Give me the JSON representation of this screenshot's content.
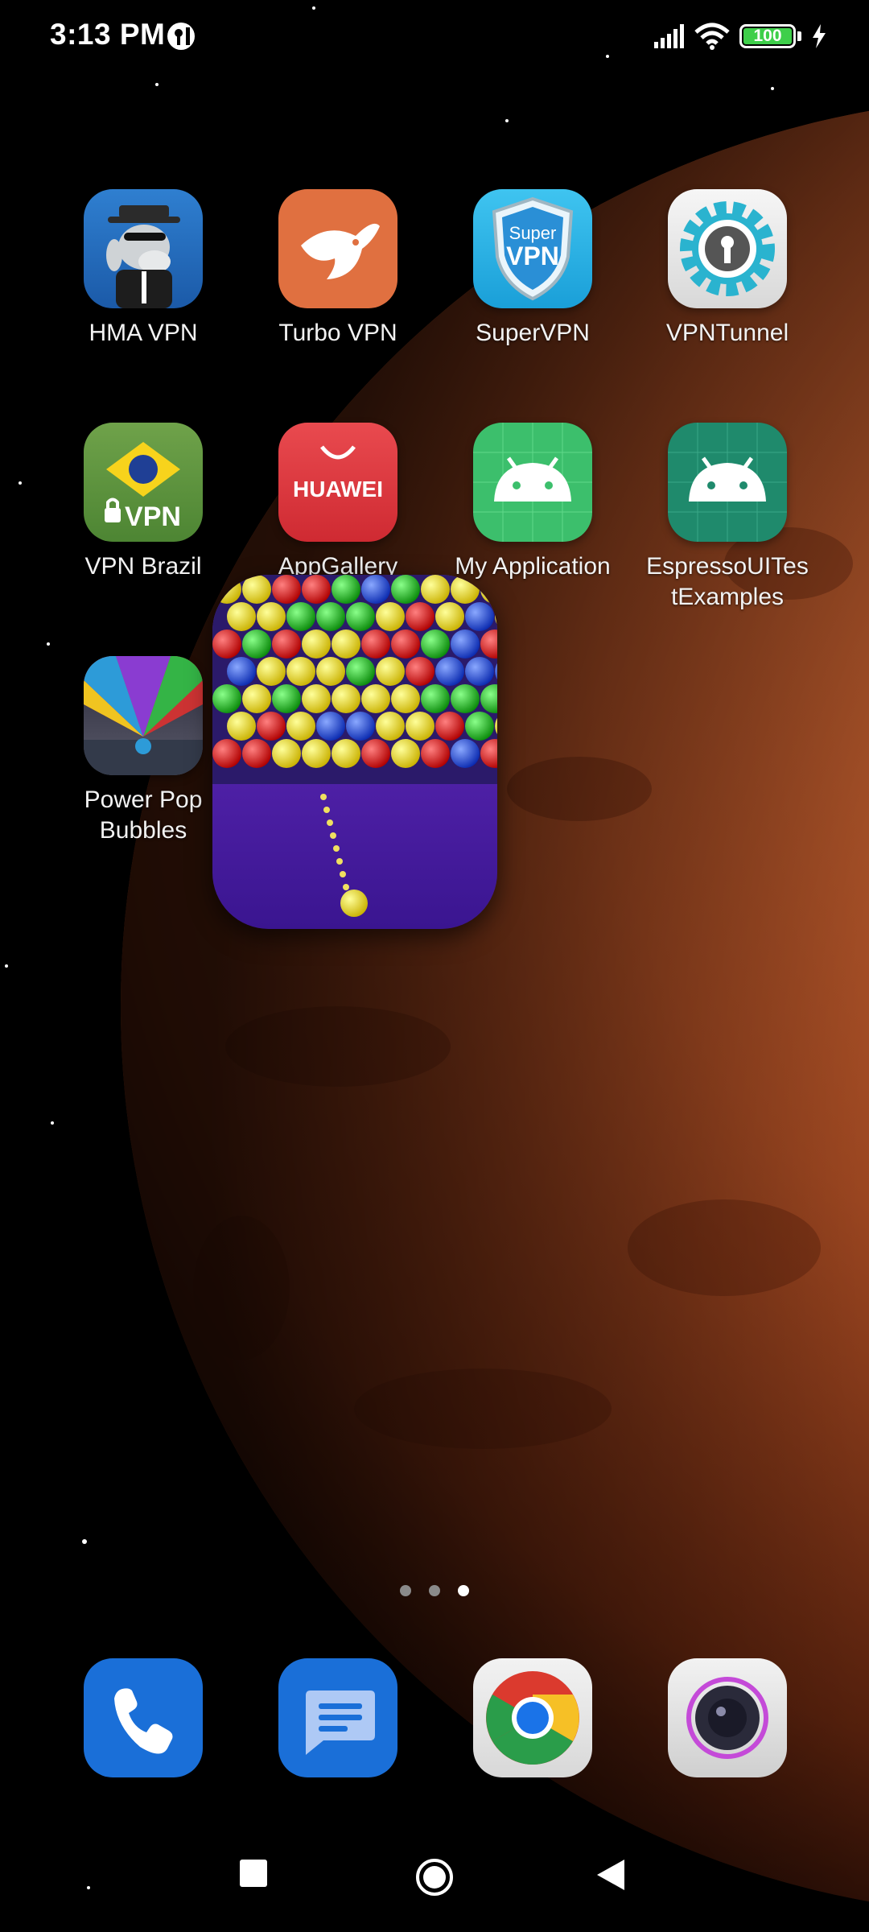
{
  "status_bar": {
    "time": "3:13 PM",
    "battery_level": "100",
    "battery_fraction": 1.0,
    "signal_icon": "cellular-signal-icon",
    "wifi_icon": "wifi-icon",
    "charging_icon": "charging-bolt-icon",
    "notification_icon": "vpn-key-notification-icon"
  },
  "apps": [
    {
      "label": "HMA VPN",
      "icon": "hma-vpn-donkey-icon"
    },
    {
      "label": "Turbo VPN",
      "icon": "turbo-vpn-rabbit-icon"
    },
    {
      "label": "SuperVPN",
      "icon": "supervpn-shield-icon",
      "icon_text_top": "Super",
      "icon_text_bottom": "VPN"
    },
    {
      "label": "VPNTunnel",
      "icon": "vpntunnel-gear-icon"
    },
    {
      "label": "VPN Brazil",
      "icon": "vpn-brazil-flag-icon",
      "icon_text": "VPN"
    },
    {
      "label": "AppGallery",
      "icon": "huawei-appgallery-icon",
      "icon_text": "HUAWEI"
    },
    {
      "label": "My Application",
      "icon": "android-robot-icon"
    },
    {
      "label": "EspressoUITes\ntExamples",
      "icon": "android-robot-icon"
    },
    {
      "label": "Power Pop\nBubbles",
      "icon": "power-pop-bubbles-icon"
    }
  ],
  "dragging_app": {
    "icon": "bubble-shooter-icon"
  },
  "page_indicator": {
    "count": 3,
    "active_index": 2
  },
  "dock": [
    {
      "icon": "phone-icon"
    },
    {
      "icon": "messages-icon"
    },
    {
      "icon": "chrome-icon"
    },
    {
      "icon": "camera-icon"
    }
  ],
  "nav_bar": {
    "recents_icon": "recents-square-icon",
    "home_icon": "home-circle-icon",
    "back_icon": "back-triangle-icon"
  },
  "colors": {
    "planet": "#c4562a",
    "turbo_vpn": "#e07040",
    "huawei": "#d8353a",
    "android_green": "#3cbf6c",
    "dock_blue": "#1a6fd8"
  }
}
